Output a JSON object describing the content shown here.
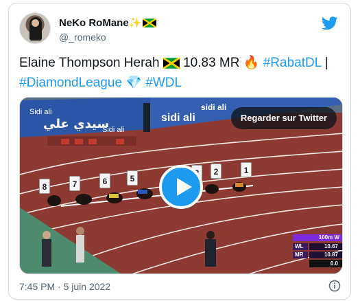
{
  "tweet": {
    "author": {
      "name": "NeKo RoMane",
      "name_emoji": "✨",
      "handle": "@_romeko"
    },
    "text": {
      "part1": "Elaine Thompson Herah ",
      "part2": " 10.83 MR ",
      "emoji_fire": "🔥",
      "hashtag1": "#RabatDL",
      "separator": " |",
      "hashtag2": "#DiamondLeague",
      "emoji_gem": "💎",
      "hashtag3": "#WDL"
    },
    "timestamp": "7:45 PM · 5 juin 2022"
  },
  "media": {
    "watch_label": "Regarder sur Twitter",
    "banner_brand": "Sidi ali",
    "banner_arabic": "سيدي علي",
    "lane_numbers": [
      "8",
      "7",
      "6",
      "5",
      "3",
      "2",
      "1"
    ],
    "scoreboard": {
      "event": "100m W",
      "rows": [
        {
          "label": "WL",
          "value": "10.67"
        },
        {
          "label": "MR",
          "value": "10.87"
        }
      ],
      "time": "0.0"
    }
  },
  "colors": {
    "accent": "#1d9bf0",
    "track": "#8c3a32",
    "grass": "#4e8a6e",
    "banner": "#2c57a6"
  }
}
